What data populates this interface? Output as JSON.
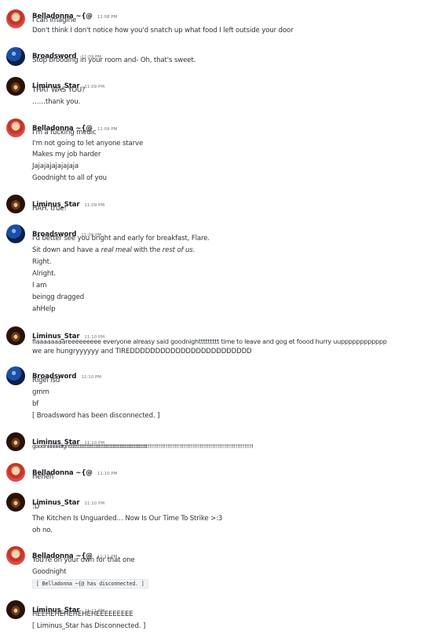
{
  "messages": [
    {
      "author": "Belladonna ~{@",
      "time": "11:08 PM",
      "lines": [
        "I can imagine",
        "Don't think I don't notice how you'd snatch up what food I left outside your door"
      ]
    },
    {
      "author": "Broadsword",
      "time": "11:09 PM",
      "lines": [
        "Stop brooding in your room and- Oh, that's sweet."
      ]
    },
    {
      "author": "Liminus_Star",
      "time": "11:09 PM",
      "lines": [
        "THAT WAS YOU?",
        "……thank you."
      ]
    },
    {
      "author": "Belladonna ~{@",
      "time": "11:09 PM",
      "lines": [
        "I'm a fucking medic",
        "I'm not going to let anyone starve",
        "Makes my job harder",
        "Jajajajajajajaja",
        "Goodnight to all of you"
      ]
    },
    {
      "author": "Liminus_Star",
      "time": "11:09 PM",
      "lines": [
        "HAH. true!"
      ]
    },
    {
      "author": "Broadsword",
      "time": "11:09 PM",
      "lines": [
        "I'd better see you bright and early for breakfast, Flare.",
        "Sit down and have a ",
        "real meal",
        " with the ",
        "rest of us",
        ".",
        "Right.",
        "Alright.",
        "I am",
        "beingg dragged",
        "ahHelp"
      ]
    },
    {
      "author": "Liminus_Star",
      "time": "11:10 PM",
      "lines": [
        "flaaaaaaaareeeeeeeee everyone alreasy said goodnighttttttttt time to leave and gog et foood hurry uupppppppppppp",
        "we are hungryyyyyy and TIREDDDDDDDDDDDDDDDDDDDDDDDD"
      ]
    },
    {
      "author": "Broadsword",
      "time": "11:10 PM",
      "lines": [
        "Rigel isd",
        "gmm",
        "bf",
        "[ Broadsword has been disconnected. ]"
      ]
    },
    {
      "author": "Liminus_Star",
      "time": "11:10 PM",
      "lines": [
        "goodniiiiiiiiiiiiiighttttttttttttttttttttttttttttttttttttttttttttt!!!!!!!!!!!!!!!!!!!!!!!!!!!!!!!!!!!!!!!!!!!!!!!!!!!!!!!!!!!"
      ]
    },
    {
      "author": "Belladonna ~{@",
      "time": "11:10 PM",
      "lines": [
        "Heheh"
      ]
    },
    {
      "author": "Liminus_Star",
      "time": "11:10 PM",
      "lines": [
        ":D",
        "The Kitchen Is Unguarded… Now Is Our Time To Strike >:3",
        "oh no."
      ]
    },
    {
      "author": "Belladonna ~{@",
      "time": "11:11 PM",
      "lines": [
        "You're on your own for that one",
        "Goodnight",
        "[ Belladonna ~{@ has disconnected. ]"
      ]
    },
    {
      "author": "Liminus_Star",
      "time": "11:11 PM",
      "lines": [
        "HEEHEHEHEHEHEHEEEEEEEEE",
        "[ Liminus_Star has Disconnected. ]"
      ]
    }
  ]
}
